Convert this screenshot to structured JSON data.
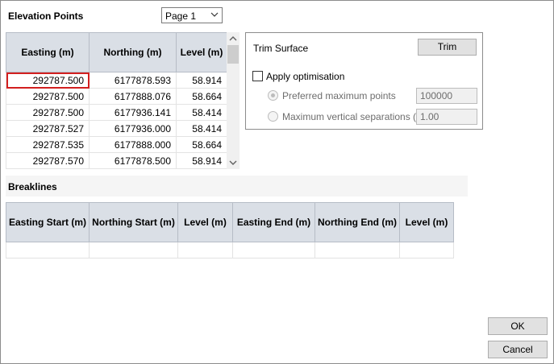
{
  "elevation": {
    "title": "Elevation Points",
    "page_select": "Page 1",
    "columns": [
      "Easting (m)",
      "Northing (m)",
      "Level (m)"
    ],
    "rows": [
      [
        "292787.500",
        "6177878.593",
        "58.914"
      ],
      [
        "292787.500",
        "6177888.076",
        "58.664"
      ],
      [
        "292787.500",
        "6177936.141",
        "58.414"
      ],
      [
        "292787.527",
        "6177936.000",
        "58.414"
      ],
      [
        "292787.535",
        "6177888.000",
        "58.664"
      ],
      [
        "292787.570",
        "6177878.500",
        "58.914"
      ]
    ]
  },
  "trim": {
    "label": "Trim Surface",
    "button": "Trim",
    "apply_optimisation": "Apply optimisation",
    "preferred_label": "Preferred maximum points",
    "preferred_value": "100000",
    "vertical_label": "Maximum vertical separations (m)",
    "vertical_value": "1.00"
  },
  "breaklines": {
    "title": "Breaklines",
    "columns": [
      "Easting Start (m)",
      "Northing Start (m)",
      "Level (m)",
      "Easting End (m)",
      "Northing End (m)",
      "Level (m)"
    ]
  },
  "footer": {
    "ok": "OK",
    "cancel": "Cancel"
  }
}
